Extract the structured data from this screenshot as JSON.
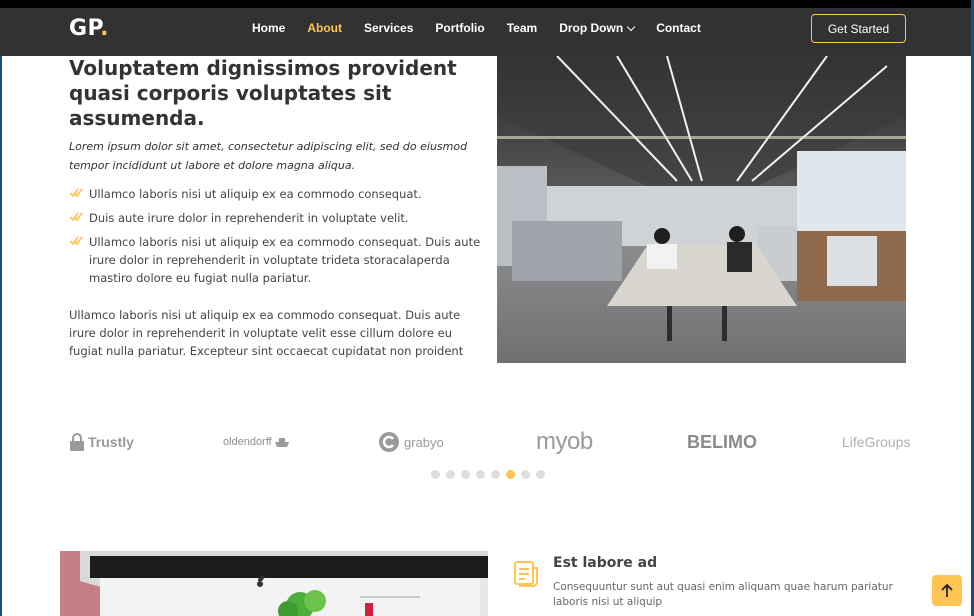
{
  "header": {
    "logo_main": "GP",
    "logo_dot": ".",
    "nav": [
      {
        "label": "Home",
        "active": false
      },
      {
        "label": "About",
        "active": true
      },
      {
        "label": "Services",
        "active": false
      },
      {
        "label": "Portfolio",
        "active": false
      },
      {
        "label": "Team",
        "active": false
      },
      {
        "label": "Drop Down",
        "active": false,
        "dropdown": true
      },
      {
        "label": "Contact",
        "active": false
      }
    ],
    "cta": "Get Started"
  },
  "about": {
    "title": "Voluptatem dignissimos provident quasi corporis voluptates sit assumenda.",
    "intro": "Lorem ipsum dolor sit amet, consectetur adipiscing elit, sed do eiusmod tempor incididunt ut labore et dolore magna aliqua.",
    "list": [
      "Ullamco laboris nisi ut aliquip ex ea commodo consequat.",
      "Duis aute irure dolor in reprehenderit in voluptate velit.",
      "Ullamco laboris nisi ut aliquip ex ea commodo consequat. Duis aute irure dolor in reprehenderit in voluptate trideta storacalaperda mastiro dolore eu fugiat nulla pariatur."
    ],
    "paragraph": "Ullamco laboris nisi ut aliquip ex ea commodo consequat. Duis aute irure dolor in reprehenderit in voluptate velit esse cillum dolore eu fugiat nulla pariatur. Excepteur sint occaecat cupidatat non proident"
  },
  "clients": {
    "logos": [
      "Trustly",
      "oldendorff",
      "grabyo",
      "myob",
      "BELIMO",
      "LifeGroups"
    ],
    "dot_count": 8,
    "active_dot": 6
  },
  "features": {
    "title": "Est labore ad",
    "text": "Consequuntur sunt aut quasi enim aliquam quae harum pariatur laboris nisi ut aliquip"
  },
  "colors": {
    "accent": "#ffc451",
    "header_bg": "#323232",
    "topbar": "#000000"
  },
  "icons": {
    "check": "double-check-icon",
    "feature": "document-text-icon",
    "back_to_top": "arrow-up-icon"
  }
}
